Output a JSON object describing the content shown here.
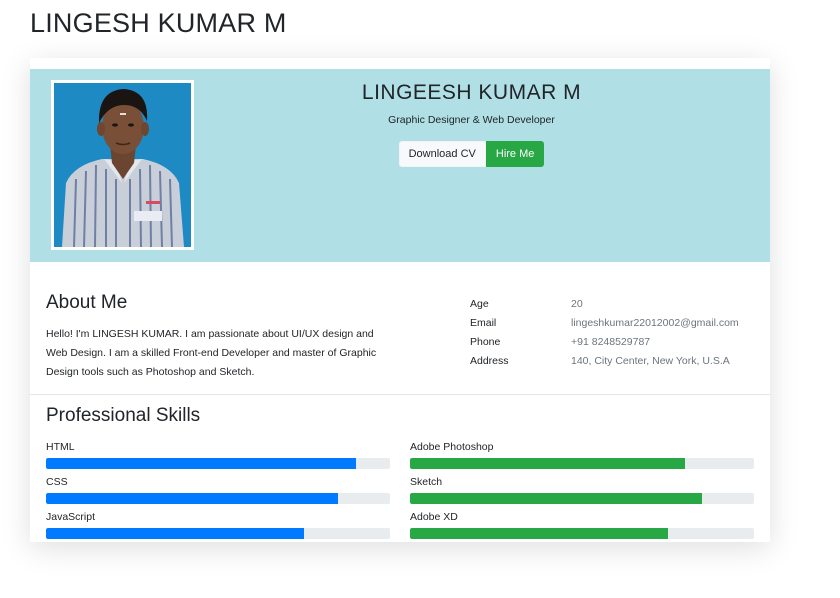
{
  "page": {
    "title": "LINGESH KUMAR M"
  },
  "profile": {
    "name": "LINGEESH KUMAR M",
    "role": "Graphic Designer & Web Developer",
    "buttons": {
      "download_cv": "Download CV",
      "hire_me": "Hire Me"
    }
  },
  "about": {
    "heading": "About Me",
    "text": "Hello! I'm LINGESH KUMAR. I am passionate about UI/UX design and Web Design. I am a skilled Front-end Developer and master of Graphic Design tools such as Photoshop and Sketch.",
    "info": [
      {
        "label": "Age",
        "value": "20"
      },
      {
        "label": "Email",
        "value": "lingeshkumar22012002@gmail.com"
      },
      {
        "label": "Phone",
        "value": "+91 8248529787"
      },
      {
        "label": "Address",
        "value": "140, City Center, New York, U.S.A"
      }
    ]
  },
  "skills": {
    "heading": "Professional Skills",
    "left": [
      {
        "name": "HTML",
        "percent": 90
      },
      {
        "name": "CSS",
        "percent": 85
      },
      {
        "name": "JavaScript",
        "percent": 75
      }
    ],
    "right": [
      {
        "name": "Adobe Photoshop",
        "percent": 80
      },
      {
        "name": "Sketch",
        "percent": 85
      },
      {
        "name": "Adobe XD",
        "percent": 75
      }
    ]
  },
  "colors": {
    "header_bg": "#b0dfe5",
    "primary": "#007bff",
    "success": "#28a745",
    "track": "#e9ecef"
  }
}
